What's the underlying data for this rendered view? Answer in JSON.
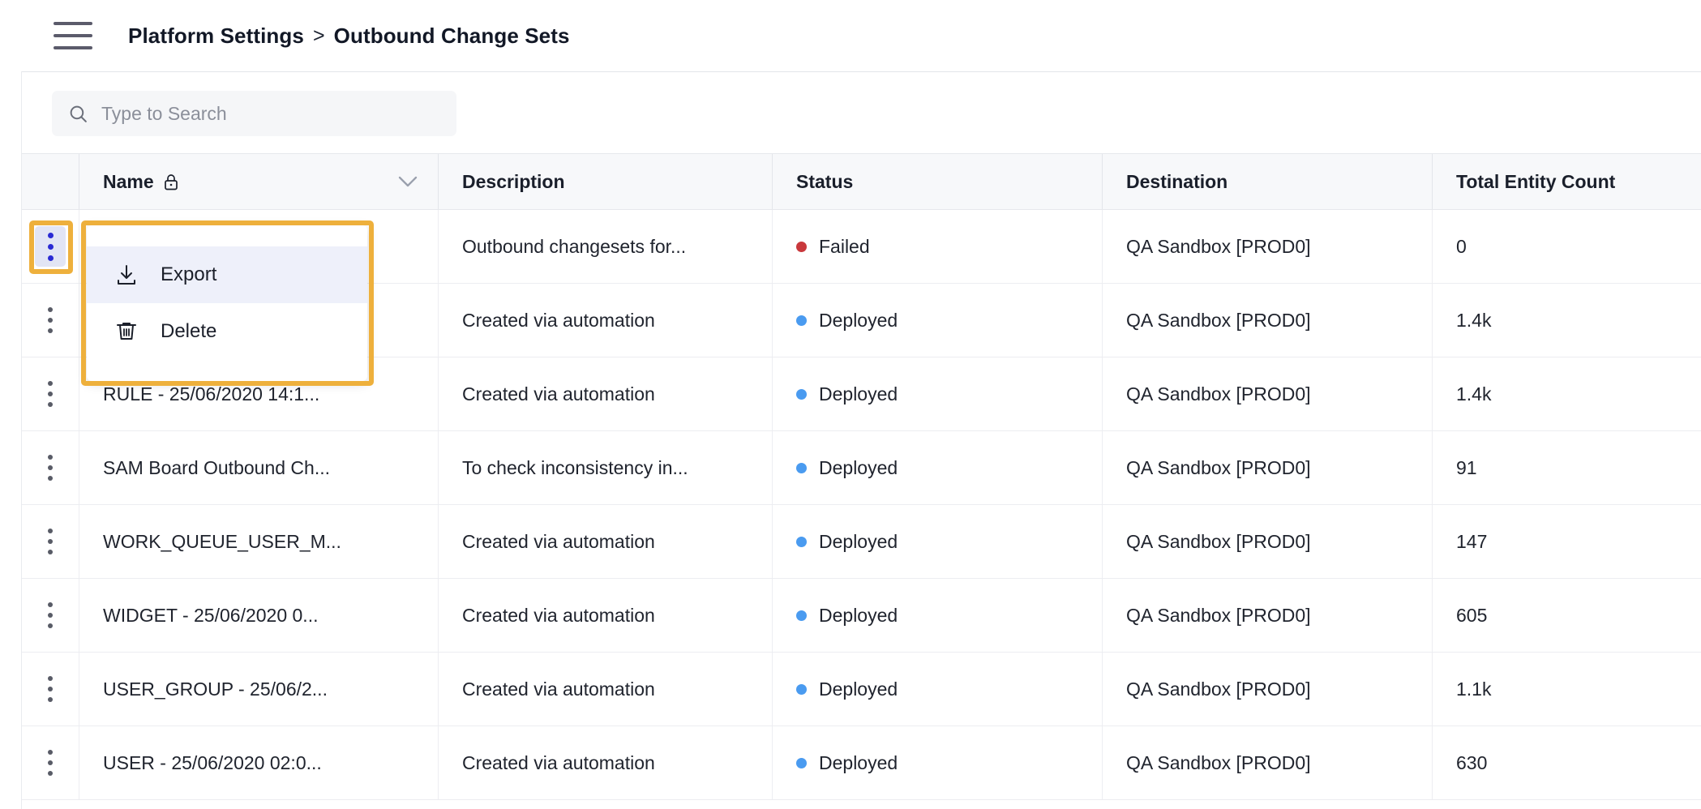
{
  "topbar": {
    "menu_icon": "hamburger-icon",
    "breadcrumb": {
      "parent": "Platform Settings",
      "separator": ">",
      "current": "Outbound Change Sets"
    }
  },
  "search": {
    "icon": "search-icon",
    "placeholder": "Type to Search",
    "value": ""
  },
  "table": {
    "columns": [
      {
        "label": "Name",
        "icon": "lock-icon",
        "sort_icon": "chevron-down-icon"
      },
      {
        "label": "Description"
      },
      {
        "label": "Status"
      },
      {
        "label": "Destination"
      },
      {
        "label": "Total Entity Count"
      }
    ],
    "row_menu_icon": "kebab-menu-icon",
    "rows": [
      {
        "name": "",
        "description": "Outbound changesets for...",
        "status": "Failed",
        "status_color": "#c9383c",
        "destination": "QA Sandbox [PROD0]",
        "total_entity_count": "0"
      },
      {
        "name": "",
        "description": "Created via automation",
        "status": "Deployed",
        "status_color": "#4a9bf0",
        "destination": "QA Sandbox [PROD0]",
        "total_entity_count": "1.4k"
      },
      {
        "name": "RULE - 25/06/2020 14:1...",
        "description": "Created via automation",
        "status": "Deployed",
        "status_color": "#4a9bf0",
        "destination": "QA Sandbox [PROD0]",
        "total_entity_count": "1.4k"
      },
      {
        "name": "SAM Board Outbound Ch...",
        "description": "To check inconsistency in...",
        "status": "Deployed",
        "status_color": "#4a9bf0",
        "destination": "QA Sandbox [PROD0]",
        "total_entity_count": "91"
      },
      {
        "name": "WORK_QUEUE_USER_M...",
        "description": "Created via automation",
        "status": "Deployed",
        "status_color": "#4a9bf0",
        "destination": "QA Sandbox [PROD0]",
        "total_entity_count": "147"
      },
      {
        "name": "WIDGET - 25/06/2020 0...",
        "description": "Created via automation",
        "status": "Deployed",
        "status_color": "#4a9bf0",
        "destination": "QA Sandbox [PROD0]",
        "total_entity_count": "605"
      },
      {
        "name": "USER_GROUP - 25/06/2...",
        "description": "Created via automation",
        "status": "Deployed",
        "status_color": "#4a9bf0",
        "destination": "QA Sandbox [PROD0]",
        "total_entity_count": "1.1k"
      },
      {
        "name": "USER - 25/06/2020 02:0...",
        "description": "Created via automation",
        "status": "Deployed",
        "status_color": "#4a9bf0",
        "destination": "QA Sandbox [PROD0]",
        "total_entity_count": "630"
      }
    ]
  },
  "context_menu": {
    "open": true,
    "items": [
      {
        "label": "Export",
        "icon": "download-icon",
        "hovered": true
      },
      {
        "label": "Delete",
        "icon": "trash-icon",
        "hovered": false
      }
    ]
  },
  "annotations": {
    "highlight_color": "#eeb03c",
    "targets": [
      "row-actions-kebab",
      "row-context-menu"
    ]
  }
}
